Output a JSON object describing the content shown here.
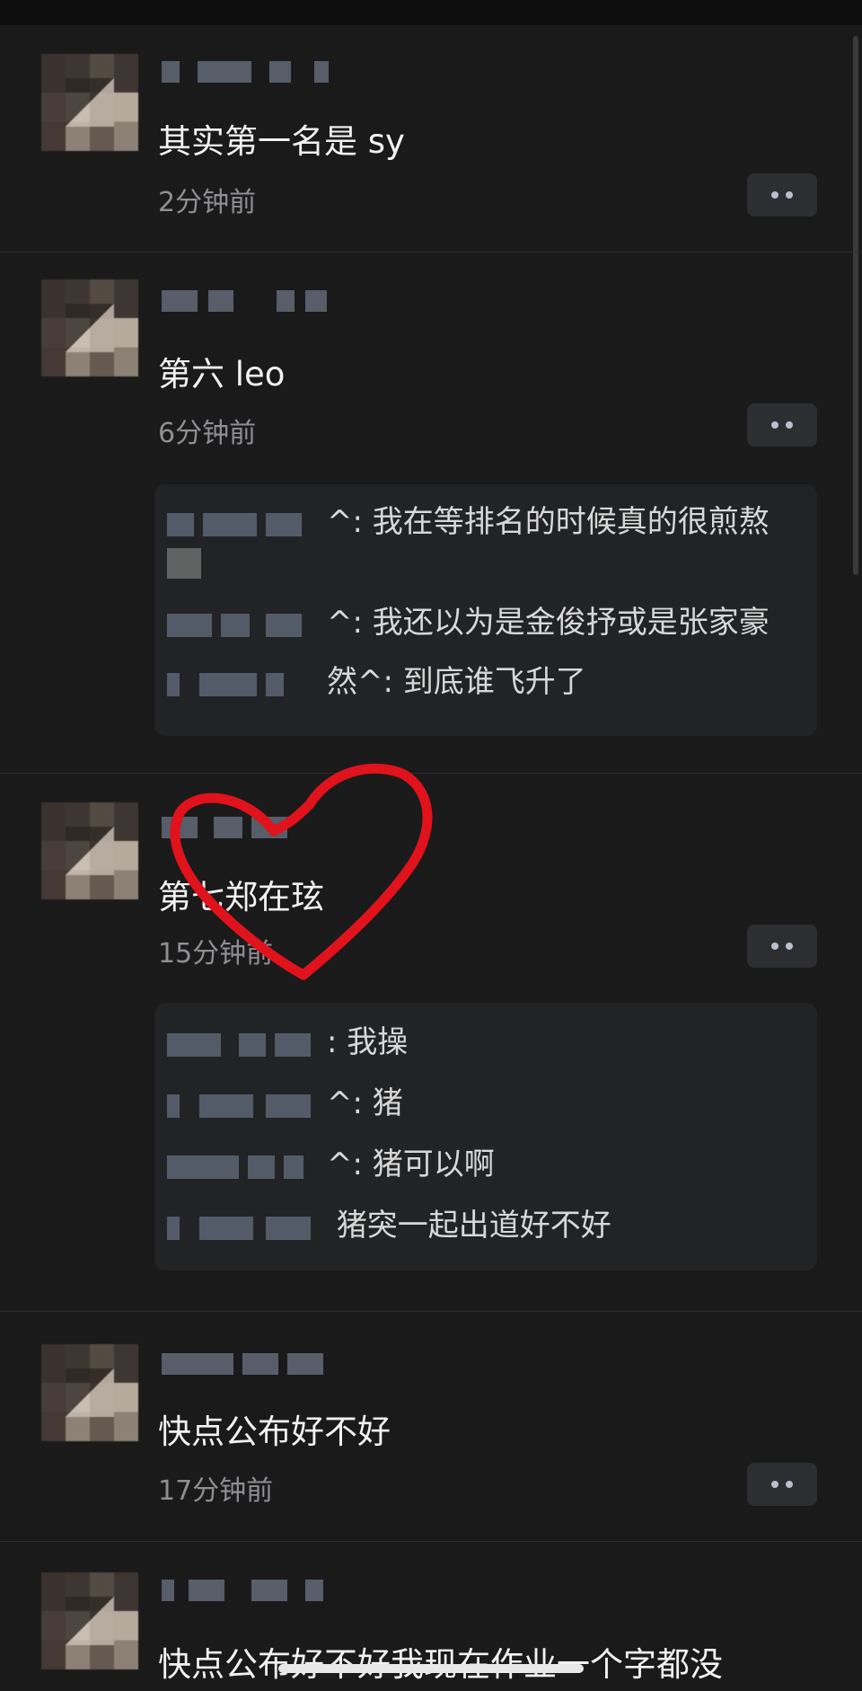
{
  "comments": [
    {
      "text": "其实第一名是 sy",
      "time": "2分钟前"
    },
    {
      "text": "第六 leo",
      "time": "6分钟前",
      "replies": [
        {
          "suffix": "^:",
          "text": "我在等排名的时候真的很煎熬"
        },
        {
          "suffix": "^:",
          "text": "我还以为是金俊抒或是张家豪"
        },
        {
          "suffix": "然^:",
          "text": "到底谁飞升了"
        }
      ]
    },
    {
      "text": "第七郑在玹",
      "time": "15分钟前",
      "replies": [
        {
          "suffix": ":",
          "text": "我操"
        },
        {
          "suffix": "^:",
          "text": "猪"
        },
        {
          "suffix": "^:",
          "text": "猪可以啊"
        },
        {
          "suffix": "",
          "text": "猪突一起出道好不好"
        }
      ]
    },
    {
      "text": "快点公布好不好",
      "time": "17分钟前"
    },
    {
      "text": "快点公布好不好我现在作业一个字都没"
    }
  ],
  "colors": {
    "background": "#1a1a1b",
    "annotation": "#e0121b"
  }
}
